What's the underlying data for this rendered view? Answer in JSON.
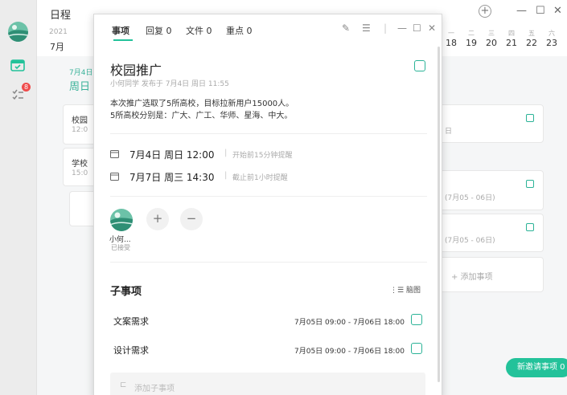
{
  "app": {
    "title": "日程"
  },
  "rail": {
    "badge": "8"
  },
  "calendar": {
    "year": "2021",
    "month": "7月",
    "weekdays": [
      "一",
      "二",
      "三",
      "四",
      "五",
      "六"
    ],
    "days": [
      "18",
      "19",
      "20",
      "21",
      "22",
      "23"
    ],
    "date_label": "7月4日",
    "weekday_label": "周日",
    "cards": [
      {
        "title": "校园",
        "sub": "12:0"
      },
      {
        "title": "学校",
        "sub": "15:0"
      }
    ],
    "right_card_text": "日",
    "range_texts": [
      "(7月05 - 06日)",
      "(7月05 - 06日)"
    ],
    "add_item": "+ 添加事项"
  },
  "float_button": {
    "label": "新邀请事项 0"
  },
  "dialog": {
    "tabs": [
      {
        "label": "事项"
      },
      {
        "label": "回复 0"
      },
      {
        "label": "文件 0"
      },
      {
        "label": "重点 0"
      }
    ],
    "event": {
      "title": "校园推广",
      "meta": "小何同学 发布于 7月4日 周日 11:55",
      "description": [
        "本次推广选取了5所高校，目标拉新用户15000人。",
        "5所高校分别是：广大、广工、华师、星海、中大。"
      ],
      "start": {
        "when": "7月4日 周日 12:00",
        "reminder": "开始前15分钟提醒"
      },
      "end": {
        "when": "7月7日 周三 14:30",
        "reminder": "截止前1小时提醒"
      }
    },
    "participant": {
      "name": "小何...",
      "status": "已接受"
    },
    "subtasks": {
      "heading": "子事项",
      "tree_view_label": "脑图",
      "items": [
        {
          "name": "文案需求",
          "range": "7月05日 09:00 - 7月06日 18:00"
        },
        {
          "name": "设计需求",
          "range": "7月05日 09:00 - 7月06日 18:00"
        }
      ],
      "add_label": "添加子事项"
    }
  },
  "colors": {
    "accent": "#23c29a",
    "check": "#2bb397",
    "badge": "#ef4b4b"
  }
}
